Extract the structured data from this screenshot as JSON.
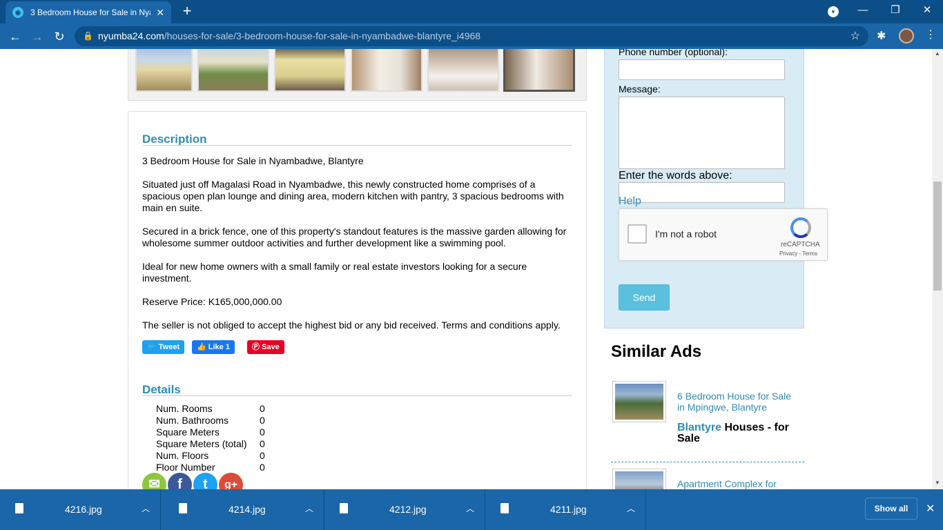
{
  "browser": {
    "tab_title": "3 Bedroom House for Sale in Nya",
    "url_host": "nyumba24.com",
    "url_path": "/houses-for-sale/3-bedroom-house-for-sale-in-nyambadwe-blantyre_i4968"
  },
  "description": {
    "heading": "Description",
    "paragraphs": [
      "3 Bedroom House for Sale in Nyambadwe, Blantyre",
      "Situated just off Magalasi Road in Nyambadwe, this newly constructed home comprises of a spacious open plan lounge and dining area, modern kitchen with pantry, 3 spacious bedrooms with main en suite.",
      "Secured in a brick fence, one of this property's standout features is the massive garden allowing for wholesome summer outdoor activities and further development like a swimming pool.",
      "Ideal for new home owners with a small family or real estate investors looking for a secure investment.",
      "Reserve Price: K165,000,000.00",
      "The seller is not obliged to accept the highest bid or any bid received. Terms and conditions apply."
    ]
  },
  "social": {
    "tweet": "Tweet",
    "like": "Like 1",
    "save": "Save"
  },
  "details": {
    "heading": "Details",
    "rows": [
      {
        "key": "Num. Rooms",
        "value": "0"
      },
      {
        "key": "Num. Bathrooms",
        "value": "0"
      },
      {
        "key": "Square Meters",
        "value": "0"
      },
      {
        "key": "Square Meters (total)",
        "value": "0"
      },
      {
        "key": "Num. Floors",
        "value": "0"
      },
      {
        "key": "Floor Number",
        "value": "0"
      }
    ]
  },
  "contact_form": {
    "phone_label": "Phone number (optional):",
    "message_label": "Message:",
    "captcha_label": "Enter the words above:",
    "help": "Help",
    "recaptcha_text": "I'm not a robot",
    "recaptcha_brand": "reCAPTCHA",
    "recaptcha_links": "Privacy - Terms",
    "send": "Send"
  },
  "similar": {
    "heading": "Similar Ads",
    "items": [
      {
        "title": "6 Bedroom House for Sale in Mpingwe, Blantyre",
        "city": "Blantyre",
        "category": " Houses - for Sale"
      },
      {
        "title": "Apartment Complex for",
        "city": "",
        "category": ""
      }
    ]
  },
  "downloads": [
    {
      "name": "4216.jpg"
    },
    {
      "name": "4214.jpg"
    },
    {
      "name": "4212.jpg"
    },
    {
      "name": "4211.jpg"
    }
  ],
  "downloads_show_all": "Show all"
}
